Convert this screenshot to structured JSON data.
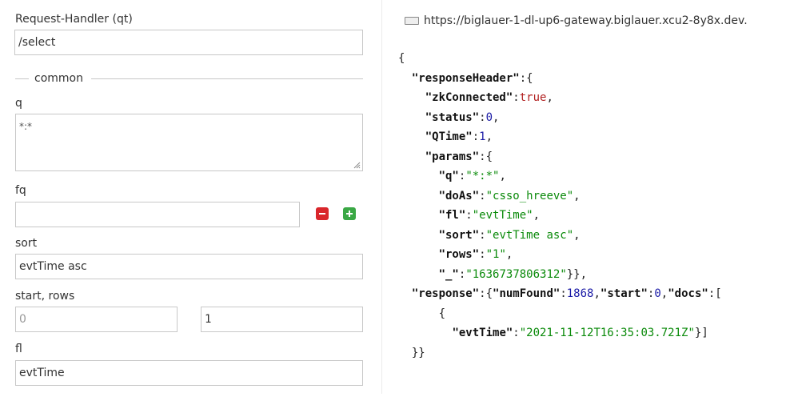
{
  "form": {
    "request_handler": {
      "label": "Request-Handler (qt)",
      "value": "/select"
    },
    "common_legend": "common",
    "q": {
      "label": "q",
      "value": "*:*"
    },
    "fq": {
      "label": "fq",
      "value": ""
    },
    "sort": {
      "label": "sort",
      "value": "evtTime asc"
    },
    "start_rows": {
      "label": "start, rows",
      "start_placeholder": "0",
      "rows_value": "1"
    },
    "fl": {
      "label": "fl",
      "value": "evtTime"
    }
  },
  "url_bar": {
    "url": "https://biglauer-1-dl-up6-gateway.biglauer.xcu2-8y8x.dev."
  },
  "response": {
    "open": "{",
    "responseHeader_key": "\"responseHeader\"",
    "zkConnected_key": "\"zkConnected\"",
    "zkConnected": "true",
    "status_key": "\"status\"",
    "status": "0",
    "qtime_key": "\"QTime\"",
    "qtime": "1",
    "params_key": "\"params\"",
    "q_key": "\"q\"",
    "q": "\"*:*\"",
    "doas_key": "\"doAs\"",
    "doas": "\"csso_hreeve\"",
    "fl_key": "\"fl\"",
    "fl": "\"evtTime\"",
    "sort_key": "\"sort\"",
    "sort": "\"evtTime asc\"",
    "rows_key": "\"rows\"",
    "rows": "\"1\"",
    "underscore_key": "\"_\"",
    "underscore": "\"1636737806312\"",
    "response_key": "\"response\"",
    "numfound_key": "\"numFound\"",
    "numfound": "1868",
    "start_key": "\"start\"",
    "start": "0",
    "docs_key": "\"docs\"",
    "doc_open": "{",
    "evttime_key": "\"evtTime\"",
    "evttime": "\"2021-11-12T16:35:03.721Z\"",
    "close": "}}"
  },
  "colors": {
    "minus_button": "#d9262b",
    "plus_button": "#3aa845",
    "border": "#c8c8c8"
  }
}
